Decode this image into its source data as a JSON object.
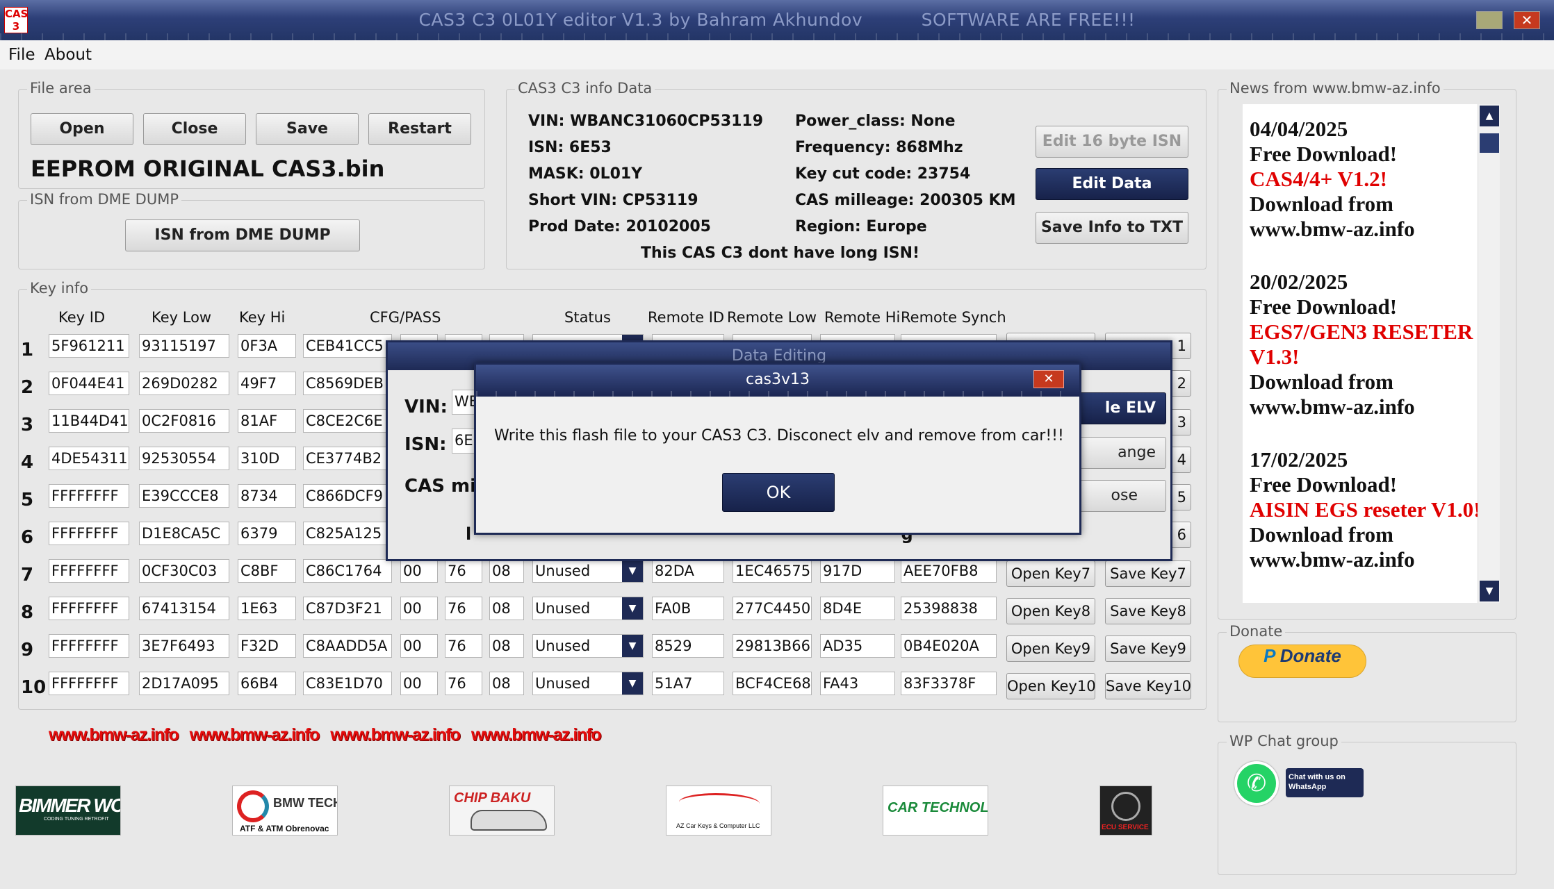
{
  "window": {
    "title": "CAS3 C3 0L01Y editor V1.3 by Bahram Akhundov          SOFTWARE ARE FREE!!!",
    "icon_text": "CAS 3"
  },
  "menu": {
    "file": "File",
    "about": "About"
  },
  "file_area": {
    "legend": "File area",
    "open": "Open",
    "close": "Close",
    "save": "Save",
    "restart": "Restart",
    "filename": "EEPROM ORIGINAL CAS3.bin"
  },
  "isn_dme": {
    "legend": "ISN from DME DUMP",
    "button": "ISN from DME DUMP"
  },
  "info": {
    "legend": "CAS3 C3 info Data",
    "vin": "VIN: WBANC31060CP53119",
    "isn": "ISN: 6E53",
    "mask": "MASK:  0L01Y",
    "short_vin": "Short VIN: CP53119",
    "prod_date": "Prod Date:  20102005",
    "power_class": "Power_class:  None",
    "frequency": "Frequency:  868Mhz",
    "key_cut": "Key cut code:  23754",
    "mileage": "CAS milleage:  200305 KM",
    "region": "Region:  Europe",
    "note": "This CAS C3 dont have long ISN!",
    "edit_isn": "Edit 16 byte ISN",
    "edit_data": "Edit Data",
    "save_txt": "Save Info to TXT"
  },
  "keys": {
    "legend": "Key info",
    "headers": {
      "key_id": "Key ID",
      "key_low": "Key Low",
      "key_hi": "Key Hi",
      "cfg": "CFG/PASS",
      "status": "Status",
      "remote_id": "Remote ID",
      "remote_low": "Remote Low",
      "remote_hi": "Remote Hi",
      "remote_synch": "Remote Synch"
    },
    "rows": [
      {
        "n": "1",
        "id": "5F961211",
        "low": "93115197",
        "hi": "0F3A",
        "cfg": "CEB41CC5"
      },
      {
        "n": "2",
        "id": "0F044E41",
        "low": "269D0282",
        "hi": "49F7",
        "cfg": "C8569DEB"
      },
      {
        "n": "3",
        "id": "11B44D41",
        "low": "0C2F0816",
        "hi": "81AF",
        "cfg": "C8CE2C6E"
      },
      {
        "n": "4",
        "id": "4DE54311",
        "low": "92530554",
        "hi": "310D",
        "cfg": "CE3774B2"
      },
      {
        "n": "5",
        "id": "FFFFFFFF",
        "low": "E39CCCE8",
        "hi": "8734",
        "cfg": "C866DCF9"
      },
      {
        "n": "6",
        "id": "FFFFFFFF",
        "low": "D1E8CA5C",
        "hi": "6379",
        "cfg": "C825A125"
      },
      {
        "n": "7",
        "id": "FFFFFFFF",
        "low": "0CF30C03",
        "hi": "C8BF",
        "cfg": "C86C1764",
        "p1": "00",
        "p2": "76",
        "p3": "08",
        "status": "Unused",
        "rid": "82DA",
        "rlow": "1EC46575",
        "rhi": "917D",
        "rsync": "AEE70FB8",
        "open": "Open Key7",
        "save": "Save Key7"
      },
      {
        "n": "8",
        "id": "FFFFFFFF",
        "low": "67413154",
        "hi": "1E63",
        "cfg": "C87D3F21",
        "p1": "00",
        "p2": "76",
        "p3": "08",
        "status": "Unused",
        "rid": "FA0B",
        "rlow": "277C4450",
        "rhi": "8D4E",
        "rsync": "25398838",
        "open": "Open Key8",
        "save": "Save Key8"
      },
      {
        "n": "9",
        "id": "FFFFFFFF",
        "low": "3E7F6493",
        "hi": "F32D",
        "cfg": "C8AADD5A",
        "p1": "00",
        "p2": "76",
        "p3": "08",
        "status": "Unused",
        "rid": "8529",
        "rlow": "29813B66",
        "rhi": "AD35",
        "rsync": "0B4E020A",
        "open": "Open Key9",
        "save": "Save Key9"
      },
      {
        "n": "10",
        "id": "FFFFFFFF",
        "low": "2D17A095",
        "hi": "66B4",
        "cfg": "C83E1D70",
        "p1": "00",
        "p2": "76",
        "p3": "08",
        "status": "Unused",
        "rid": "51A7",
        "rlow": "BCF4CE68",
        "rhi": "FA43",
        "rsync": "83F3378F",
        "open": "Open Key10",
        "save": "Save Key10"
      }
    ],
    "partial_right": [
      "1",
      "2",
      "3",
      "4",
      "5",
      "6"
    ]
  },
  "links": "www.bmw-az.info   www.bmw-az.info   www.bmw-az.info   www.bmw-az.info",
  "logos": {
    "bimmer": "BIMMER WORKS",
    "bimmer_sub": "CODING TUNING RETROFIT",
    "bmw_tech": "BMW TECHNIC",
    "bmw_tech_sub": "ATF & ATM Obrenovac",
    "chip": "CHIP BAKU",
    "az_car": "AZ Car Keys & Computer LLC",
    "car_tech": "CAR TECHNOLOGY",
    "ecu": "ECU SERVICE"
  },
  "news": {
    "legend": "News from www.bmw-az.info",
    "items": [
      {
        "date": "04/04/2025",
        "line1": "Free Download!",
        "red": "CAS4/4+ V1.2!",
        "line2": "Download from",
        "line3": "www.bmw-az.info"
      },
      {
        "date": "20/02/2025",
        "line1": "Free Download!",
        "red": "EGS7/GEN3 RESETER V1.3!",
        "line2": "Download from",
        "line3": "www.bmw-az.info"
      },
      {
        "date": "17/02/2025",
        "line1": "Free Download!",
        "red": "AISIN EGS reseter V1.0!",
        "line2": "Download from",
        "line3": "www.bmw-az.info"
      }
    ]
  },
  "donate": {
    "legend": "Donate",
    "button": "Donate"
  },
  "whatsapp": {
    "legend": "WP Chat group",
    "badge": "Chat with us on WhatsApp"
  },
  "data_editing": {
    "title": "Data Editing",
    "vin_label": "VIN:",
    "vin_value": "WE",
    "isn_label": "ISN:",
    "isn_value": "6E",
    "cas_label": "CAS mi",
    "elv_btn": "le ELV",
    "change_btn": "ange",
    "close_btn": "ose",
    "bottom_text": "l                                                                          g"
  },
  "message": {
    "title": "cas3v13",
    "text": "Write this flash file to your CAS3 C3. Disconect elv and remove from car!!!",
    "ok": "OK"
  },
  "colors": {
    "title_bar": "#233566",
    "accent_dark": "#1e2a55",
    "link_red": "#e40c0c",
    "news_red": "#e00000",
    "donate_yellow": "#ffc439"
  }
}
